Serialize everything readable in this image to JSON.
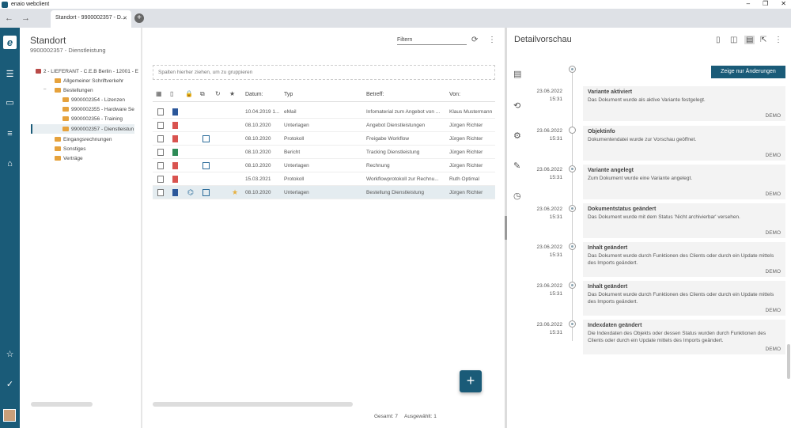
{
  "window": {
    "title": "enaio webclient",
    "controls": [
      "–",
      "❐",
      "✕"
    ]
  },
  "browser": {
    "tab_label": "Standort - 9900002357 - D...",
    "tab_close": "✕",
    "new_tab": "+"
  },
  "tree": {
    "title": "Standort",
    "subtitle": "9900002357 - Dienstleistung",
    "items": [
      {
        "label": "2 - LIEFERANT - C.E.B Berlin - 12001 - E"
      },
      {
        "label": "Allgemeiner Schriftverkehr"
      },
      {
        "label": "Bestellungen"
      },
      {
        "label": "9900002354 - Lizenzen"
      },
      {
        "label": "9900002355 - Hardware Se"
      },
      {
        "label": "9900002356 - Training"
      },
      {
        "label": "9900002357 - Dienstleistun"
      },
      {
        "label": "Eingangsrechnungen"
      },
      {
        "label": "Sonstiges"
      },
      {
        "label": "Verträge"
      }
    ],
    "toggle_open": "–"
  },
  "list": {
    "filter_label": "Filtern",
    "group_hint": "Spalten hierher ziehen, um zu gruppieren",
    "columns": {
      "date": "Datum:",
      "type": "Typ",
      "subject": "Betreff:",
      "from": "Von:",
      "star": "★"
    },
    "rows": [
      {
        "date": "10.04.2019 1...",
        "type": "eMail",
        "subject": "Infomaterial zum Angebot von ...",
        "from": "Klaus Mustermann"
      },
      {
        "date": "08.10.2020",
        "type": "Unterlagen",
        "subject": "Angebot Dienstleistungen",
        "from": "Jürgen Richter"
      },
      {
        "date": "08.10.2020",
        "type": "Protokoll",
        "subject": "Freigabe Workflow",
        "from": "Jürgen Richter"
      },
      {
        "date": "08.10.2020",
        "type": "Bericht",
        "subject": "Tracking Dienstleistung",
        "from": "Jürgen Richter"
      },
      {
        "date": "08.10.2020",
        "type": "Unterlagen",
        "subject": "Rechnung",
        "from": "Jürgen Richter"
      },
      {
        "date": "15.03.2021",
        "type": "Protokoll",
        "subject": "Workflowprotokoll zur Rechnu...",
        "from": "Ruth Optimal"
      },
      {
        "date": "08.10.2020",
        "type": "Unterlagen",
        "subject": "Bestellung Dienstleistung",
        "from": "Jürgen Richter"
      }
    ],
    "total": "Gesamt: 7",
    "selected": "Ausgewählt: 1",
    "fab": "+"
  },
  "detail": {
    "title": "Detailvorschau",
    "diff_button": "Zeige nur Änderungen",
    "events": [
      {
        "date": "23.06.2022",
        "time": "15:31",
        "title": "Variante aktiviert",
        "body": "Das Dokument wurde als aktive Variante festgelegt.",
        "user": "DEMO"
      },
      {
        "date": "23.06.2022",
        "time": "15:31",
        "title": "Objektinfo",
        "body": "Dokumentendatei wurde zur Vorschau geöffnet.",
        "user": "DEMO"
      },
      {
        "date": "23.06.2022",
        "time": "15:31",
        "title": "Variante angelegt",
        "body": "Zum Dokument wurde eine Variante angelegt.",
        "user": "DEMO"
      },
      {
        "date": "23.06.2022",
        "time": "15:31",
        "title": "Dokumentstatus geändert",
        "body": "Das Dokument wurde mit dem Status 'Nicht archivierbar' versehen.",
        "user": "DEMO"
      },
      {
        "date": "23.06.2022",
        "time": "15:31",
        "title": "Inhalt geändert",
        "body": "Das Dokument wurde durch Funktionen des Clients oder durch ein Update mittels des Imports geändert.",
        "user": "DEMO"
      },
      {
        "date": "23.06.2022",
        "time": "15:31",
        "title": "Inhalt geändert",
        "body": "Das Dokument wurde durch Funktionen des Clients oder durch ein Update mittels des Imports geändert.",
        "user": "DEMO"
      },
      {
        "date": "23.06.2022",
        "time": "15:31",
        "title": "Indexdaten geändert",
        "body": "Die Indexdaten des Objekts oder dessen Status wurden durch Funktionen des Clients oder durch ein Update mittels des Imports geändert.",
        "user": "DEMO"
      }
    ]
  }
}
